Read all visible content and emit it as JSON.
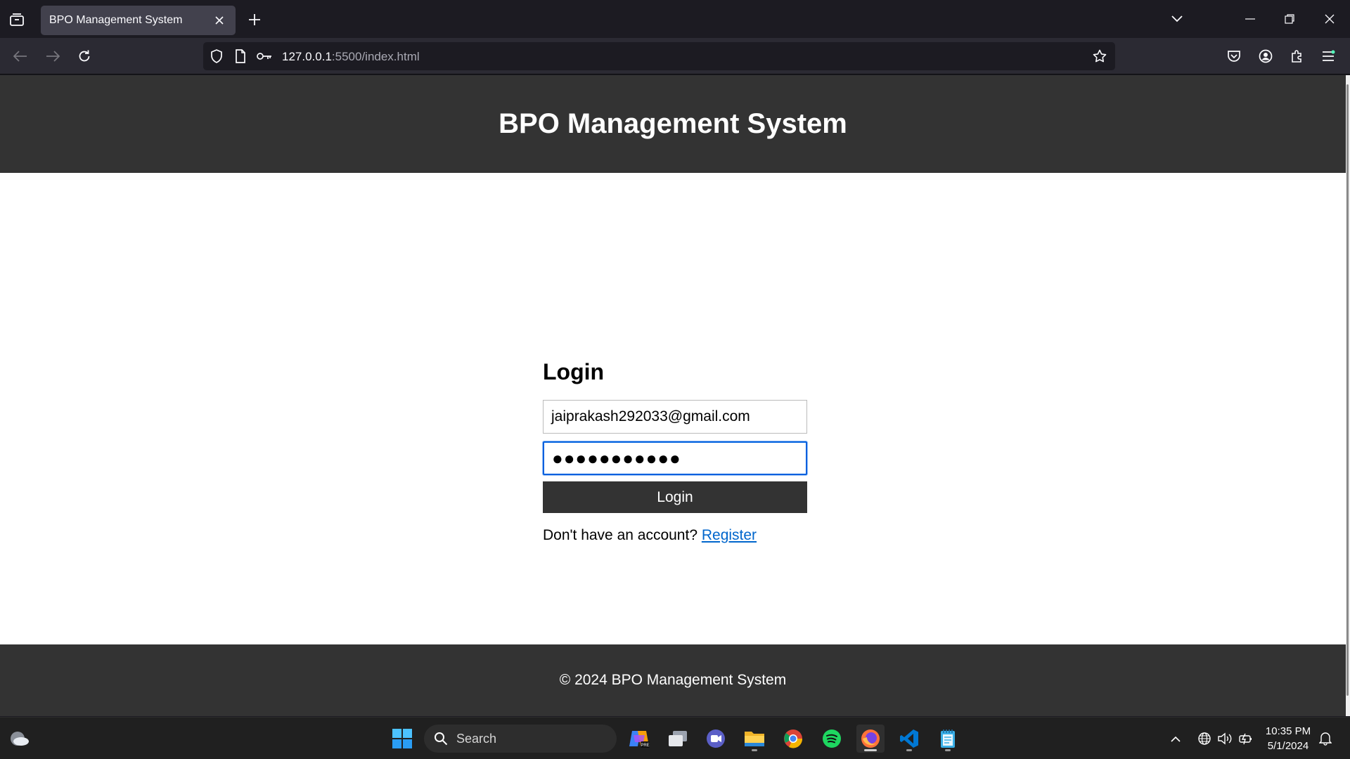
{
  "browser": {
    "tab": {
      "title": "BPO Management System"
    },
    "url": {
      "host": "127.0.0.1",
      "rest": ":5500/index.html"
    }
  },
  "page": {
    "header_title": "BPO Management System",
    "login": {
      "heading": "Login",
      "email_value": "jaiprakash292033@gmail.com",
      "password_masked": "●●●●●●●●●●●",
      "button_label": "Login",
      "no_account_text": "Don't have an account?",
      "register_link": "Register"
    },
    "footer_text": "© 2024 BPO Management System"
  },
  "taskbar": {
    "search_label": "Search",
    "clock_time": "10:35 PM",
    "clock_date": "5/1/2024"
  },
  "colors": {
    "header_bg": "#333333",
    "link": "#0066cc",
    "focus_ring": "#0060df"
  }
}
